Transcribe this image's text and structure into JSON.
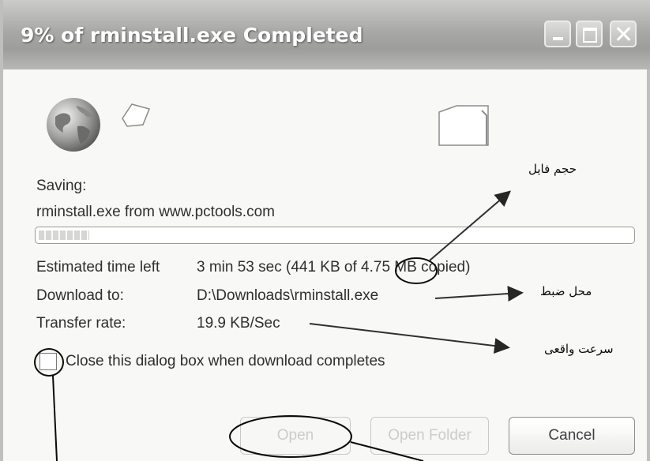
{
  "window": {
    "title": "9% of rminstall.exe Completed"
  },
  "icons": {
    "globe": "globe-icon",
    "page": "document-icon",
    "folder": "folder-icon",
    "minimize": "minimize-icon",
    "maximize": "maximize-icon",
    "close": "close-icon"
  },
  "download": {
    "saving_label": "Saving:",
    "source": "rminstall.exe from www.pctools.com",
    "progress_percent": 9,
    "estimated_label": "Estimated time left",
    "estimated_value": "3 min 53 sec (441 KB of 4.75 MB copied)",
    "download_to_label": "Download to:",
    "download_to_value": "D:\\Downloads\\rminstall.exe",
    "transfer_rate_label": "Transfer rate:",
    "transfer_rate_value": "19.9 KB/Sec",
    "close_checkbox_label": "Close this dialog box when download completes",
    "close_checkbox_checked": false
  },
  "buttons": {
    "open": "Open",
    "open_folder": "Open Folder",
    "cancel": "Cancel"
  },
  "annotations": {
    "file_size": "حجم فایل",
    "save_location": "محل ضبط",
    "real_speed": "سرعت واقعی"
  }
}
